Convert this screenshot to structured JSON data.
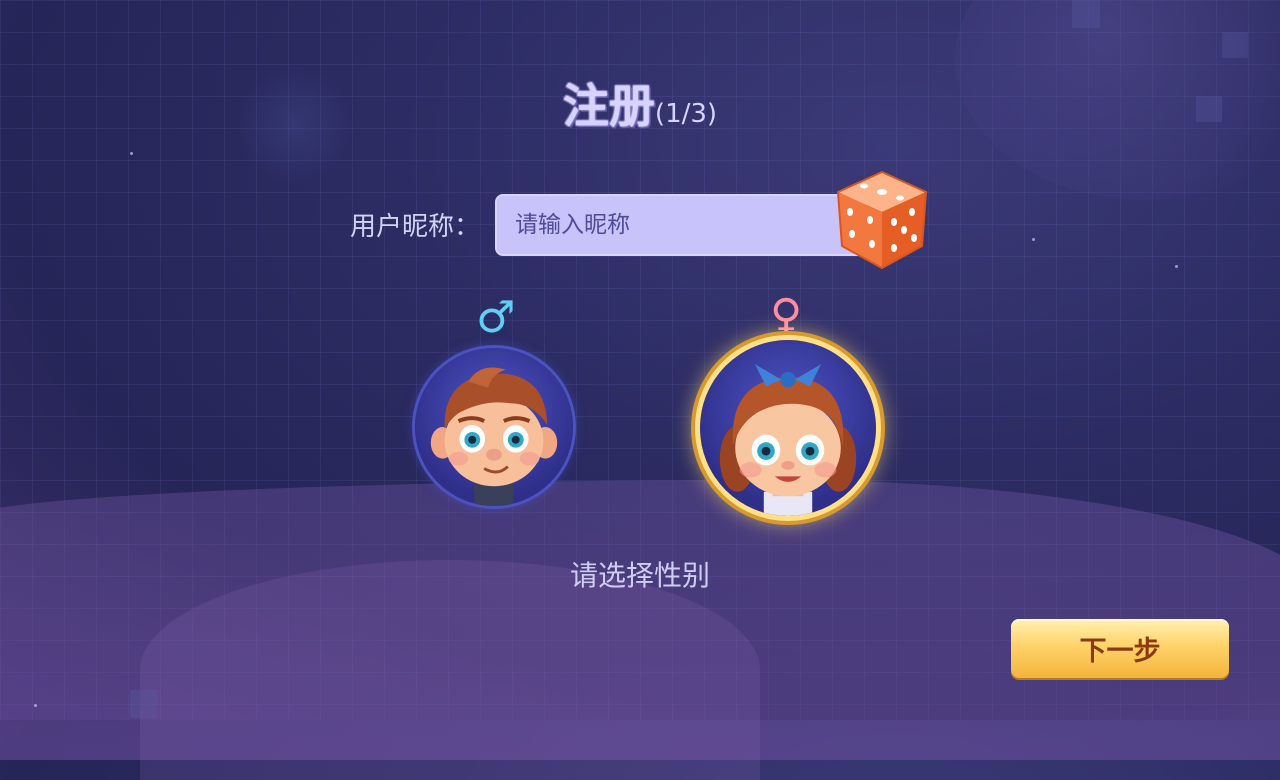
{
  "title": "注册",
  "step": "(1/3)",
  "nickname": {
    "label": "用户昵称：",
    "placeholder": "请输入昵称",
    "value": ""
  },
  "dice_icon": "random-dice-icon",
  "gender": {
    "male_symbol": "♂",
    "female_symbol": "♀",
    "selected": "female",
    "hint": "请选择性别"
  },
  "next_button": "下一步",
  "colors": {
    "male_symbol": "#5fd0f5",
    "female_symbol": "#ff8da0",
    "input_bg": "#c8c4fb",
    "button_gold": "#ffd36a",
    "button_text": "#8c3a12"
  }
}
